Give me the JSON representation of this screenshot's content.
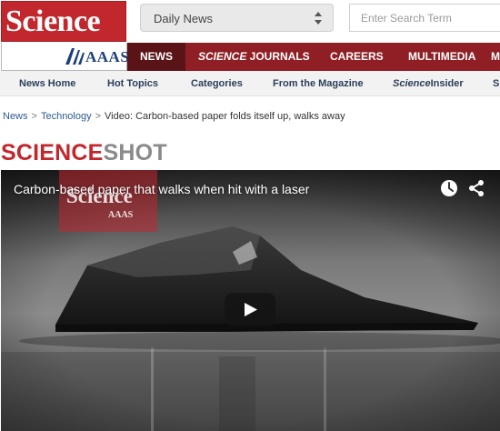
{
  "header": {
    "logo": "Science",
    "section_dropdown": {
      "selected": "Daily News"
    },
    "search": {
      "placeholder": "Enter Search Term"
    }
  },
  "nav": {
    "publisher": "AAAS",
    "items": [
      {
        "label": "NEWS",
        "active": true
      },
      {
        "label_prefix": "SCIENCE",
        "label": " JOURNALS"
      },
      {
        "label": "CAREERS"
      },
      {
        "label": "MULTIMEDIA"
      },
      {
        "label": "M"
      }
    ]
  },
  "subnav": {
    "items": [
      {
        "label": "News Home"
      },
      {
        "label": "Hot Topics"
      },
      {
        "label": "Categories"
      },
      {
        "label": "From the Magazine"
      },
      {
        "label_prefix": "Science",
        "label": "Insider"
      },
      {
        "label": "S"
      }
    ]
  },
  "breadcrumb": {
    "items": [
      "News",
      "Technology"
    ],
    "separator": ">",
    "current": "Video: Carbon-based paper folds itself up, walks away"
  },
  "section_title": {
    "part1": "SCIENCE",
    "part2": "SHOT"
  },
  "video": {
    "title": "Carbon-based paper that walks when hit with a laser",
    "watermark": {
      "logo": "Science",
      "publisher": "AAAS"
    },
    "icons": [
      "clock-icon",
      "share-icon",
      "play-icon"
    ]
  },
  "colors": {
    "brand_red": "#c1272d",
    "nav_red": "#8f1f25",
    "nav_active": "#5a1418",
    "aaas_blue": "#1c3f7a",
    "subnav_bg": "#f2f2f2",
    "link_blue": "#2d5a8e",
    "shot_gray": "#8a8a8a"
  }
}
